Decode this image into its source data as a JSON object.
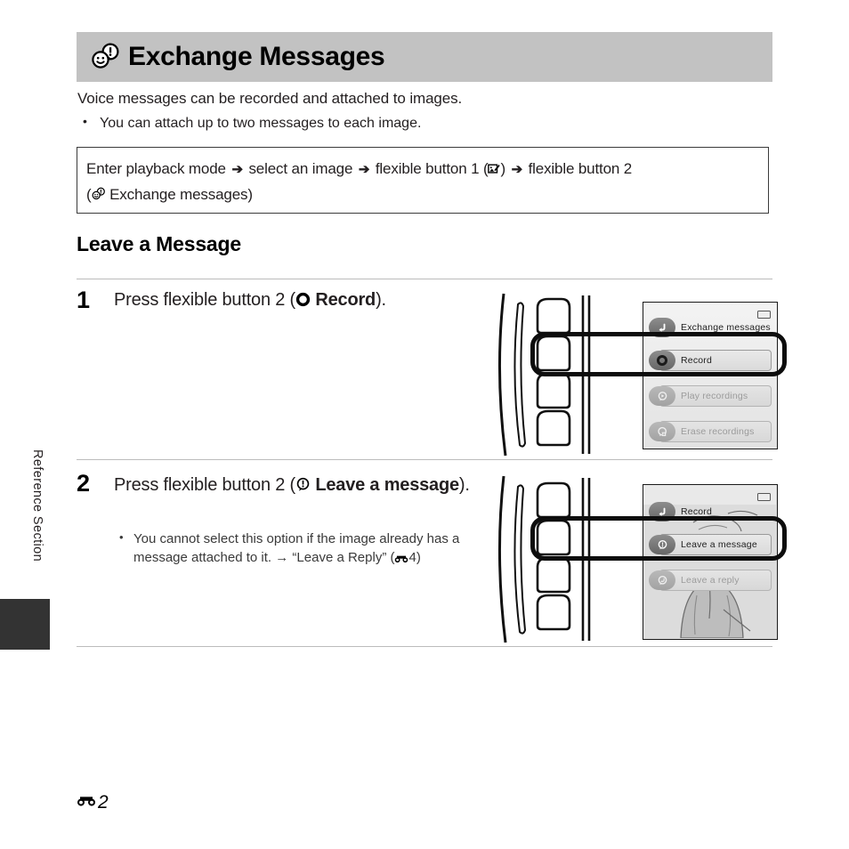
{
  "sidebar": {
    "tab_label": "Reference Section"
  },
  "header": {
    "title": "Exchange Messages",
    "icon": "exchange-messages-icon"
  },
  "intro": {
    "paragraph": "Voice messages can be recorded and attached to images.",
    "bullets": [
      "You can attach up to two messages to each image."
    ]
  },
  "path_box": {
    "line1_part1": "Enter playback mode",
    "arrow": "➔",
    "line1_part2": "select an image",
    "line1_part3": "flexible button 1 (",
    "line1_icon": "edit-image-icon",
    "line1_part4": ") ",
    "line1_part5": "flexible button 2",
    "line2_open": "(",
    "line2_icon": "exchange-messages-icon",
    "line2_text": "Exchange messages)"
  },
  "section": {
    "heading": "Leave a Message"
  },
  "steps": [
    {
      "number": "1",
      "text_before": "Press flexible button 2 (",
      "icon": "record-ring-icon",
      "bold_text": "Record",
      "text_after": ")."
    },
    {
      "number": "2",
      "text_before": "Press flexible button 2 (",
      "icon": "speech-bubble-exclaim-icon",
      "bold_text": "Leave a message",
      "text_after": ").",
      "notes": [
        {
          "part1": "You cannot select this option if the image already has a message attached to it. → “Leave a Reply” (",
          "icon": "reference-binoculars-icon",
          "page": "4",
          "part2": ")"
        }
      ]
    }
  ],
  "camera_screens": [
    {
      "name": "screen-record-menu",
      "header_row": {
        "label": "Exchange messages",
        "icon": "back-arrow-icon",
        "state": "enabled"
      },
      "rows": [
        {
          "label": "Record",
          "icon": "record-dot-icon",
          "state": "selected"
        },
        {
          "label": "Play recordings",
          "icon": "play-bubble-icon",
          "state": "disabled"
        },
        {
          "label": "Erase recordings",
          "icon": "erase-bubble-icon",
          "state": "disabled"
        }
      ],
      "battery": "battery-icon",
      "highlighted_button_index": 2
    },
    {
      "name": "screen-leave-message-menu",
      "header_row": {
        "label": "Record",
        "icon": "back-arrow-icon",
        "state": "enabled"
      },
      "rows": [
        {
          "label": "Leave a message",
          "icon": "speech-bubble-exclaim-icon",
          "state": "selected"
        },
        {
          "label": "Leave a reply",
          "icon": "reply-bubble-icon",
          "state": "disabled"
        }
      ],
      "battery": "battery-icon",
      "highlighted_button_index": 2
    }
  ],
  "footer": {
    "icon": "reference-binoculars-icon",
    "page_number": "2"
  },
  "colors": {
    "header_band": "#c2c2c2",
    "side_tab_block": "#333333",
    "rule": "#bcbcbc",
    "text": "#231f20"
  }
}
